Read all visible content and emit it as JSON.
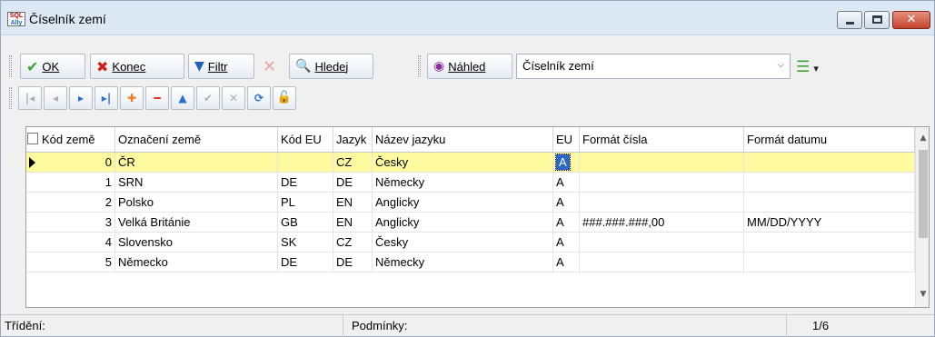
{
  "window": {
    "title": "Číselník zemí",
    "app_icon_text": [
      "SQL",
      "Ally"
    ],
    "minimize_icon": "minimize-icon",
    "maximize_icon": "maximize-icon",
    "close_icon": "close-icon",
    "close_glyph": "✕"
  },
  "toolbar": {
    "ok_label": "OK",
    "ok_icon": "✔",
    "konec_label": "Konec",
    "konec_icon": "✖",
    "filtr_label": "Filtr",
    "filtr_icon": "▼",
    "clear_filter_icon": "✕",
    "hledej_label": "Hledej",
    "hledej_icon": "🔍",
    "nahled_label": "Náhled",
    "nahled_icon": "◉",
    "view_select_value": "Číselník zemí",
    "view_select_arrow": "⌵",
    "list_icon": "☰",
    "list_dropdown": "▾"
  },
  "nav": {
    "first": "|◂",
    "prev": "◂",
    "next": "▸",
    "last": "▸|",
    "add": "✚",
    "delete": "━",
    "edit": "▲",
    "post": "✔",
    "cancel": "✕",
    "refresh": "⟳",
    "lock": "🔓"
  },
  "colors": {
    "selected_row": "#fdfa9f",
    "ok_green": "#3aa532",
    "konec_red": "#d0201e",
    "filter_blue": "#1f5fbf",
    "nahled_purple": "#8a2da0",
    "nav_blue": "#2a6fd1",
    "nav_red": "#e0341d",
    "nav_orange": "#f07a1c",
    "lock_green": "#2e8b2e"
  },
  "grid": {
    "columns": [
      "Kód země",
      "Označení země",
      "Kód EU",
      "Jazyk",
      "Název jazyku",
      "EU",
      "Formát čísla",
      "Formát datumu"
    ],
    "rows": [
      [
        "0",
        "ČR",
        "",
        "CZ",
        "Česky",
        "A",
        "",
        ""
      ],
      [
        "1",
        "SRN",
        "DE",
        "DE",
        "Německy",
        "A",
        "",
        ""
      ],
      [
        "2",
        "Polsko",
        "PL",
        "EN",
        "Anglicky",
        "A",
        "",
        ""
      ],
      [
        "3",
        "Velká Británie",
        "GB",
        "EN",
        "Anglicky",
        "A",
        "###.###.###,00",
        "MM/DD/YYYY"
      ],
      [
        "4",
        "Slovensko",
        "SK",
        "CZ",
        "Česky",
        "A",
        "",
        ""
      ],
      [
        "5",
        "Německo",
        "DE",
        "DE",
        "Německy",
        "A",
        "",
        ""
      ]
    ],
    "selected_row_index": 0,
    "scroll_up": "▲",
    "scroll_down": "▼"
  },
  "status": {
    "sort_label": "Třídění:",
    "conditions_label": "Podmínky:",
    "position": "1/6"
  }
}
